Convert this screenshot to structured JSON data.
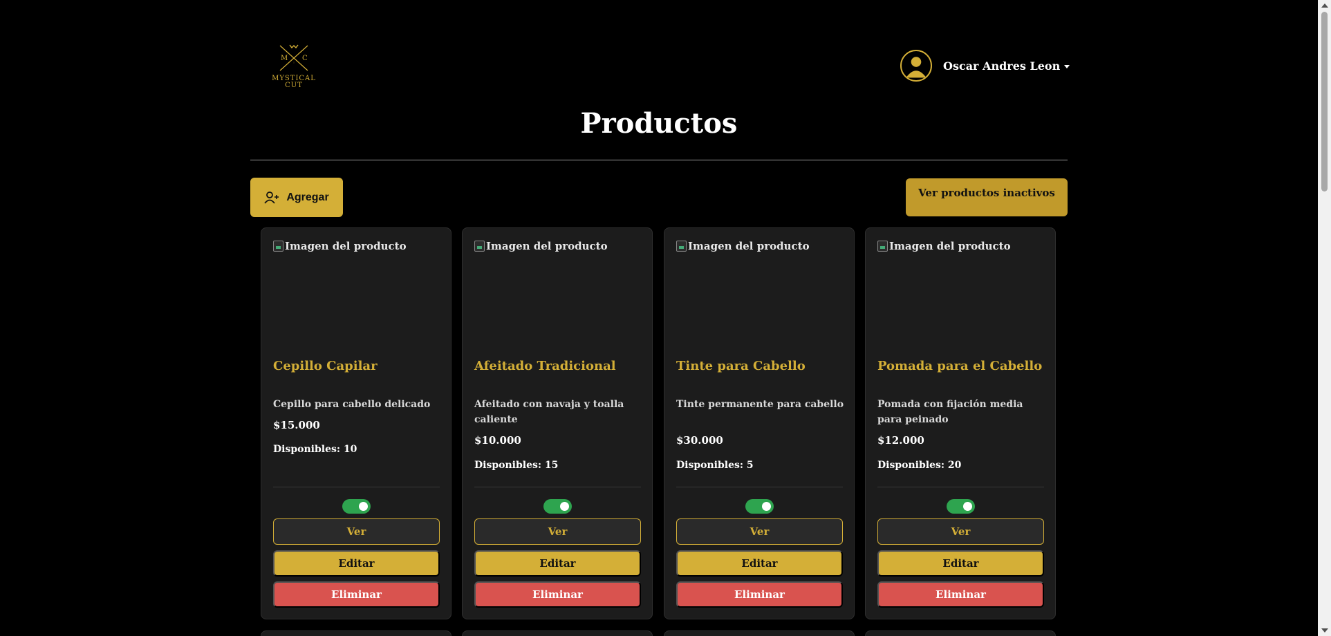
{
  "brand": {
    "logo_initials_left": "M",
    "logo_initials_right": "C",
    "logo_line1": "MYSTICAL",
    "logo_line2": "CUT"
  },
  "user": {
    "name": "Oscar Andres Leon"
  },
  "page_title": "Productos",
  "toolbar": {
    "add_label": "Agregar",
    "inactive_label": "Ver productos inactivos"
  },
  "colors": {
    "accent": "#d4af37",
    "danger": "#d9534f",
    "toggle_on": "#2ea44f",
    "card_bg": "#1c1c1c"
  },
  "products": [
    {
      "image_alt": "Imagen del producto",
      "name": "Cepillo Capilar",
      "description": "Cepillo para cabello delicado",
      "price": "$15.000",
      "stock": "Disponibles: 10",
      "active": true,
      "view_label": "Ver",
      "edit_label": "Editar",
      "delete_label": "Eliminar"
    },
    {
      "image_alt": "Imagen del producto",
      "name": "Afeitado Tradicional",
      "description": "Afeitado con navaja y toalla caliente",
      "price": "$10.000",
      "stock": "Disponibles: 15",
      "active": true,
      "view_label": "Ver",
      "edit_label": "Editar",
      "delete_label": "Eliminar"
    },
    {
      "image_alt": "Imagen del producto",
      "name": "Tinte para Cabello",
      "description": "Tinte permanente para cabello",
      "price": "$30.000",
      "stock": "Disponibles: 5",
      "active": true,
      "view_label": "Ver",
      "edit_label": "Editar",
      "delete_label": "Eliminar"
    },
    {
      "image_alt": "Imagen del producto",
      "name": "Pomada para el Cabello",
      "description": "Pomada con fijación media para peinado",
      "price": "$12.000",
      "stock": "Disponibles: 20",
      "active": true,
      "view_label": "Ver",
      "edit_label": "Editar",
      "delete_label": "Eliminar"
    }
  ]
}
